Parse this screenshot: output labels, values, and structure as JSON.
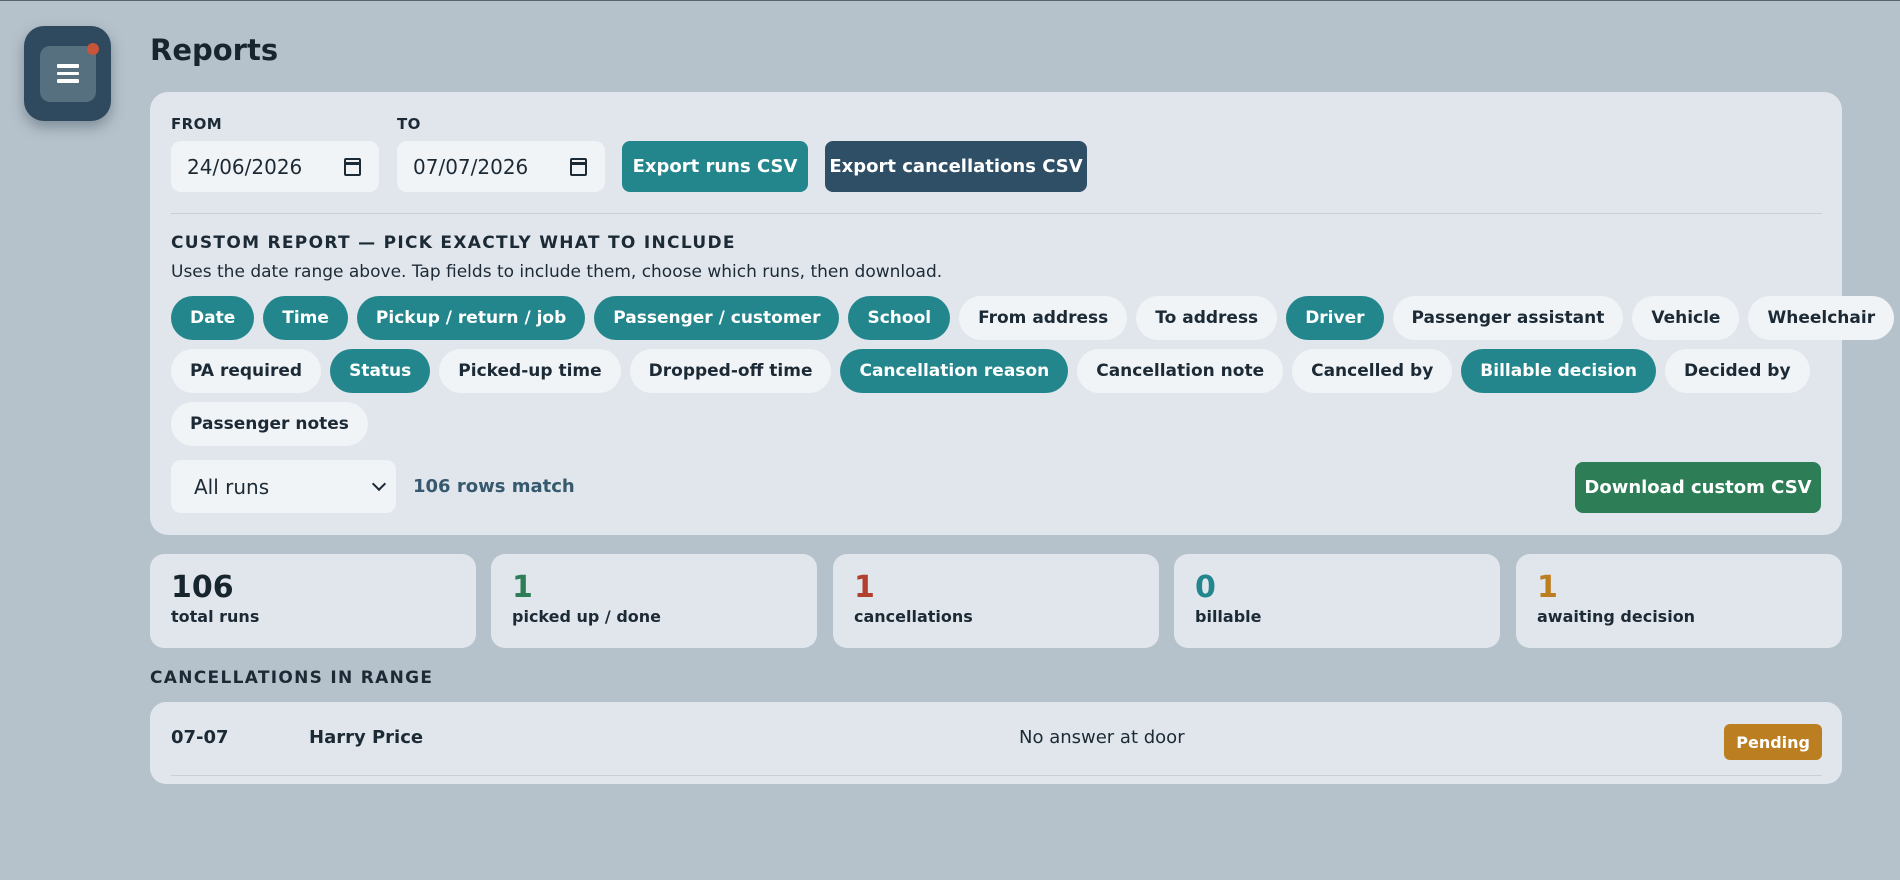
{
  "page": {
    "title": "Reports"
  },
  "menu": {
    "icon": "hamburger-menu-icon",
    "notification_color": "#c8553a"
  },
  "filters": {
    "from_label": "FROM",
    "from_value": "24/06/2026",
    "to_label": "TO",
    "to_value": "07/07/2026",
    "export_runs": "Export runs CSV",
    "export_cancellations": "Export cancellations CSV"
  },
  "custom_report": {
    "heading": "CUSTOM REPORT — PICK EXACTLY WHAT TO INCLUDE",
    "description": "Uses the date range above. Tap fields to include them, choose which runs, then download.",
    "fields": [
      [
        {
          "label": "Date",
          "selected": true
        },
        {
          "label": "Time",
          "selected": true
        },
        {
          "label": "Pickup / return / job",
          "selected": true
        },
        {
          "label": "Passenger / customer",
          "selected": true
        },
        {
          "label": "School",
          "selected": true
        },
        {
          "label": "From address",
          "selected": false
        },
        {
          "label": "To address",
          "selected": false
        },
        {
          "label": "Driver",
          "selected": true
        },
        {
          "label": "Passenger assistant",
          "selected": false
        },
        {
          "label": "Vehicle",
          "selected": false
        },
        {
          "label": "Wheelchair",
          "selected": false
        }
      ],
      [
        {
          "label": "PA required",
          "selected": false
        },
        {
          "label": "Status",
          "selected": true
        },
        {
          "label": "Picked-up time",
          "selected": false
        },
        {
          "label": "Dropped-off time",
          "selected": false
        },
        {
          "label": "Cancellation reason",
          "selected": true
        },
        {
          "label": "Cancellation note",
          "selected": false
        },
        {
          "label": "Cancelled by",
          "selected": false
        },
        {
          "label": "Billable decision",
          "selected": true
        },
        {
          "label": "Decided by",
          "selected": false
        }
      ],
      [
        {
          "label": "Passenger notes",
          "selected": false
        }
      ]
    ],
    "runs_filter": "All runs",
    "rows_match": "106 rows match",
    "download": "Download custom CSV"
  },
  "stats": [
    {
      "value": "106",
      "label": "total runs",
      "color": "#17252f"
    },
    {
      "value": "1",
      "label": "picked up / done",
      "color": "#2d7d57"
    },
    {
      "value": "1",
      "label": "cancellations",
      "color": "#b2402e"
    },
    {
      "value": "0",
      "label": "billable",
      "color": "#23868c"
    },
    {
      "value": "1",
      "label": "awaiting decision",
      "color": "#bb7f22"
    }
  ],
  "cancellations": {
    "heading": "CANCELLATIONS IN RANGE",
    "rows": [
      {
        "date": "07-07",
        "name": "Harry Price",
        "reason": "No answer at door",
        "status": "Pending"
      }
    ]
  },
  "colors": {
    "accent_teal": "#23868c",
    "navy": "#2f4f66",
    "green": "#2d7d57",
    "pending": "#bb7f22"
  }
}
